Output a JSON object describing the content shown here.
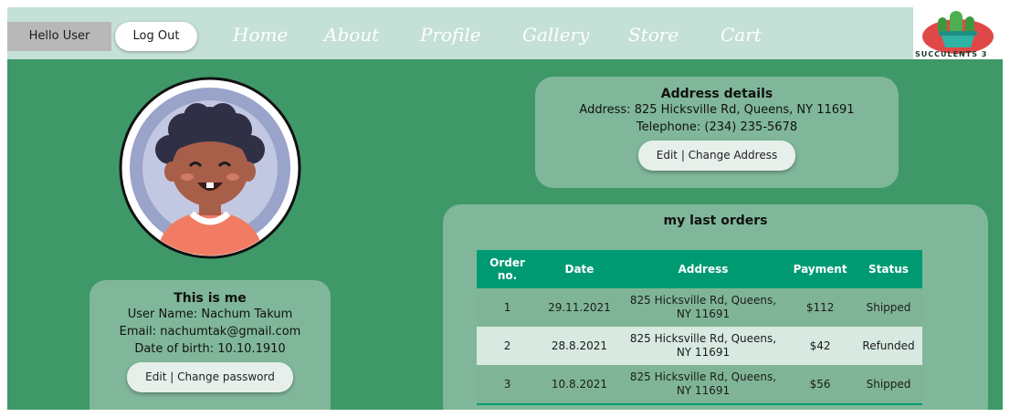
{
  "header": {
    "greeting": "Hello User",
    "logout_label": "Log Out",
    "nav": {
      "home": "Home",
      "about": "About",
      "profile": "Profile",
      "gallery": "Gallery",
      "store": "Store",
      "cart": "Cart"
    },
    "logo_text": "SUCCULENTS 3"
  },
  "profile": {
    "title": "This is me",
    "user_name": "User Name: Nachum Takum",
    "email": "Email: nachumtak@gmail.com",
    "dob": "Date of birth: 10.10.1910",
    "edit_button": "Edit | Change password"
  },
  "address": {
    "title": "Address details",
    "address_line": "Address: 825 Hicksville Rd, Queens, NY 11691",
    "telephone": "Telephone: (234) 235-5678",
    "edit_button": "Edit | Change Address"
  },
  "orders": {
    "title": "my last orders",
    "columns": {
      "order_no": "Order no.",
      "date": "Date",
      "address": "Address",
      "payment": "Payment",
      "status": "Status"
    },
    "rows": [
      {
        "no": "1",
        "date": "29.11.2021",
        "address": "825 Hicksville Rd, Queens, NY 11691",
        "payment": "$112",
        "status": "Shipped"
      },
      {
        "no": "2",
        "date": "28.8.2021",
        "address": "825 Hicksville Rd, Queens, NY 11691",
        "payment": "$42",
        "status": "Refunded"
      },
      {
        "no": "3",
        "date": "10.8.2021",
        "address": "825 Hicksville Rd, Queens, NY 11691",
        "payment": "$56",
        "status": "Shipped"
      }
    ]
  },
  "colors": {
    "page_background": "#3f9868",
    "navbar": "#c5e0d6",
    "card": "#80b79a",
    "table_header": "#009a72"
  },
  "icons": {
    "logo": "cactus-logo-icon",
    "avatar": "user-avatar-icon"
  }
}
